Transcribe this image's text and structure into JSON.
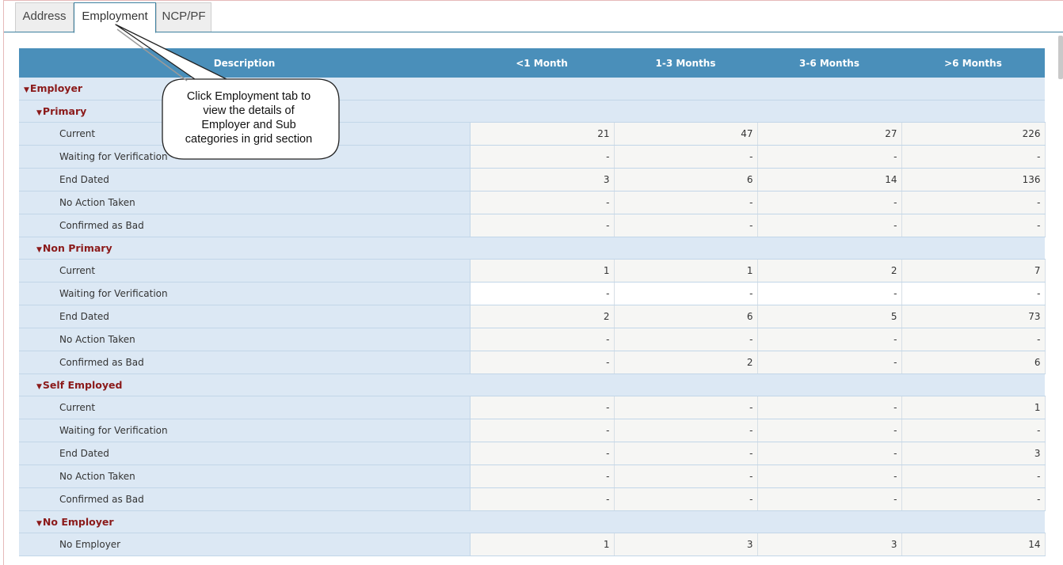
{
  "tabs": [
    {
      "label": "Address"
    },
    {
      "label": "Employment"
    },
    {
      "label": "NCP/PF"
    }
  ],
  "grid": {
    "headers": [
      "Description",
      "<1 Month",
      "1-3 Months",
      "3-6 Months",
      ">6 Months"
    ],
    "root_group": "Employer",
    "groups": [
      {
        "label": "Primary",
        "rows": [
          {
            "label": "Current",
            "values": [
              "21",
              "47",
              "27",
              "226"
            ]
          },
          {
            "label": "Waiting for Verification",
            "values": [
              "-",
              "-",
              "-",
              "-"
            ]
          },
          {
            "label": "End Dated",
            "values": [
              "3",
              "6",
              "14",
              "136"
            ]
          },
          {
            "label": "No Action Taken",
            "values": [
              "-",
              "-",
              "-",
              "-"
            ]
          },
          {
            "label": "Confirmed as Bad",
            "values": [
              "-",
              "-",
              "-",
              "-"
            ]
          }
        ]
      },
      {
        "label": "Non Primary",
        "rows": [
          {
            "label": "Current",
            "values": [
              "1",
              "1",
              "2",
              "7"
            ]
          },
          {
            "label": "Waiting for Verification",
            "values": [
              "-",
              "-",
              "-",
              "-"
            ]
          },
          {
            "label": "End Dated",
            "values": [
              "2",
              "6",
              "5",
              "73"
            ]
          },
          {
            "label": "No Action Taken",
            "values": [
              "-",
              "-",
              "-",
              "-"
            ]
          },
          {
            "label": "Confirmed as Bad",
            "values": [
              "-",
              "2",
              "-",
              "6"
            ]
          }
        ]
      },
      {
        "label": "Self Employed",
        "rows": [
          {
            "label": "Current",
            "values": [
              "-",
              "-",
              "-",
              "1"
            ]
          },
          {
            "label": "Waiting for Verification",
            "values": [
              "-",
              "-",
              "-",
              "-"
            ]
          },
          {
            "label": "End Dated",
            "values": [
              "-",
              "-",
              "-",
              "3"
            ]
          },
          {
            "label": "No Action Taken",
            "values": [
              "-",
              "-",
              "-",
              "-"
            ]
          },
          {
            "label": "Confirmed as Bad",
            "values": [
              "-",
              "-",
              "-",
              "-"
            ]
          }
        ]
      },
      {
        "label": "No Employer",
        "rows": [
          {
            "label": "No Employer",
            "values": [
              "1",
              "3",
              "3",
              "14"
            ]
          }
        ]
      }
    ]
  },
  "callout": {
    "text_lines": [
      "Click Employment tab to",
      "view the details of",
      "Employer and Sub",
      "categories in grid section"
    ]
  },
  "icons": {
    "expand_caret": "caret-down-icon"
  },
  "colors": {
    "header_bg": "#4a8fba",
    "group_text": "#8b1a1a",
    "desc_bg": "#dce8f4"
  }
}
